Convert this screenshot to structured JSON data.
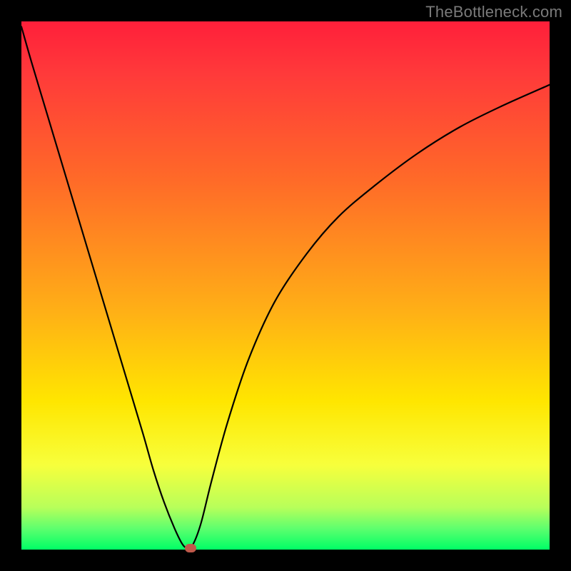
{
  "watermark": "TheBottleneck.com",
  "chart_data": {
    "type": "line",
    "title": "",
    "xlabel": "",
    "ylabel": "",
    "xlim": [
      0,
      100
    ],
    "ylim": [
      0,
      100
    ],
    "x": [
      0,
      2,
      5,
      8,
      11,
      14,
      17,
      20,
      23,
      25,
      27,
      29,
      30.5,
      31.5,
      32.5,
      34,
      36,
      39,
      43,
      48,
      54,
      60,
      67,
      75,
      83,
      91,
      100
    ],
    "values": [
      99,
      92,
      82,
      72,
      62,
      52,
      42,
      32,
      22,
      15,
      9,
      4,
      1,
      0.3,
      1,
      5,
      13,
      24,
      36,
      47,
      56,
      63,
      69,
      75,
      80,
      84,
      88
    ],
    "marker": {
      "x": 32,
      "y": 0.3
    },
    "gradient_colors": {
      "top": "#ff1f3a",
      "mid": "#ffe600",
      "bottom": "#00ff66"
    }
  }
}
